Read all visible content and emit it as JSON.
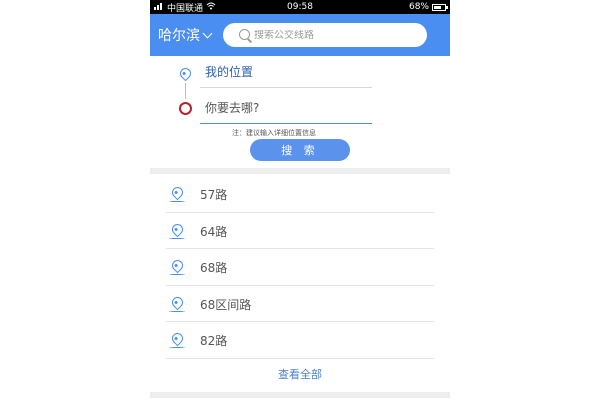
{
  "status_bar": {
    "carrier": "中国联通",
    "time": "09:58",
    "battery": "68%",
    "battery_level": 0.68
  },
  "header": {
    "city": "哈尔滨",
    "search_placeholder": "搜索公交线路"
  },
  "route_form": {
    "origin": "我的位置",
    "destination_placeholder": "你要去哪?",
    "note": "注：建议输入详细位置信息",
    "search_button": "搜 索"
  },
  "routes": [
    {
      "name": "57路"
    },
    {
      "name": "64路"
    },
    {
      "name": "68路"
    },
    {
      "name": "68区间路"
    },
    {
      "name": "82路"
    }
  ],
  "view_all": "查看全部",
  "colors": {
    "brand_blue": "#4a8ef2",
    "destination_red": "#b2232a",
    "link_blue": "#4a7fd4"
  },
  "icons": {
    "signal": "signal-icon",
    "wifi": "wifi-icon",
    "battery": "battery-icon",
    "city_dropdown": "chevron-down-icon",
    "search": "search-icon",
    "origin": "location-pin-icon",
    "destination": "destination-circle-icon",
    "route_item": "location-pin-icon"
  }
}
